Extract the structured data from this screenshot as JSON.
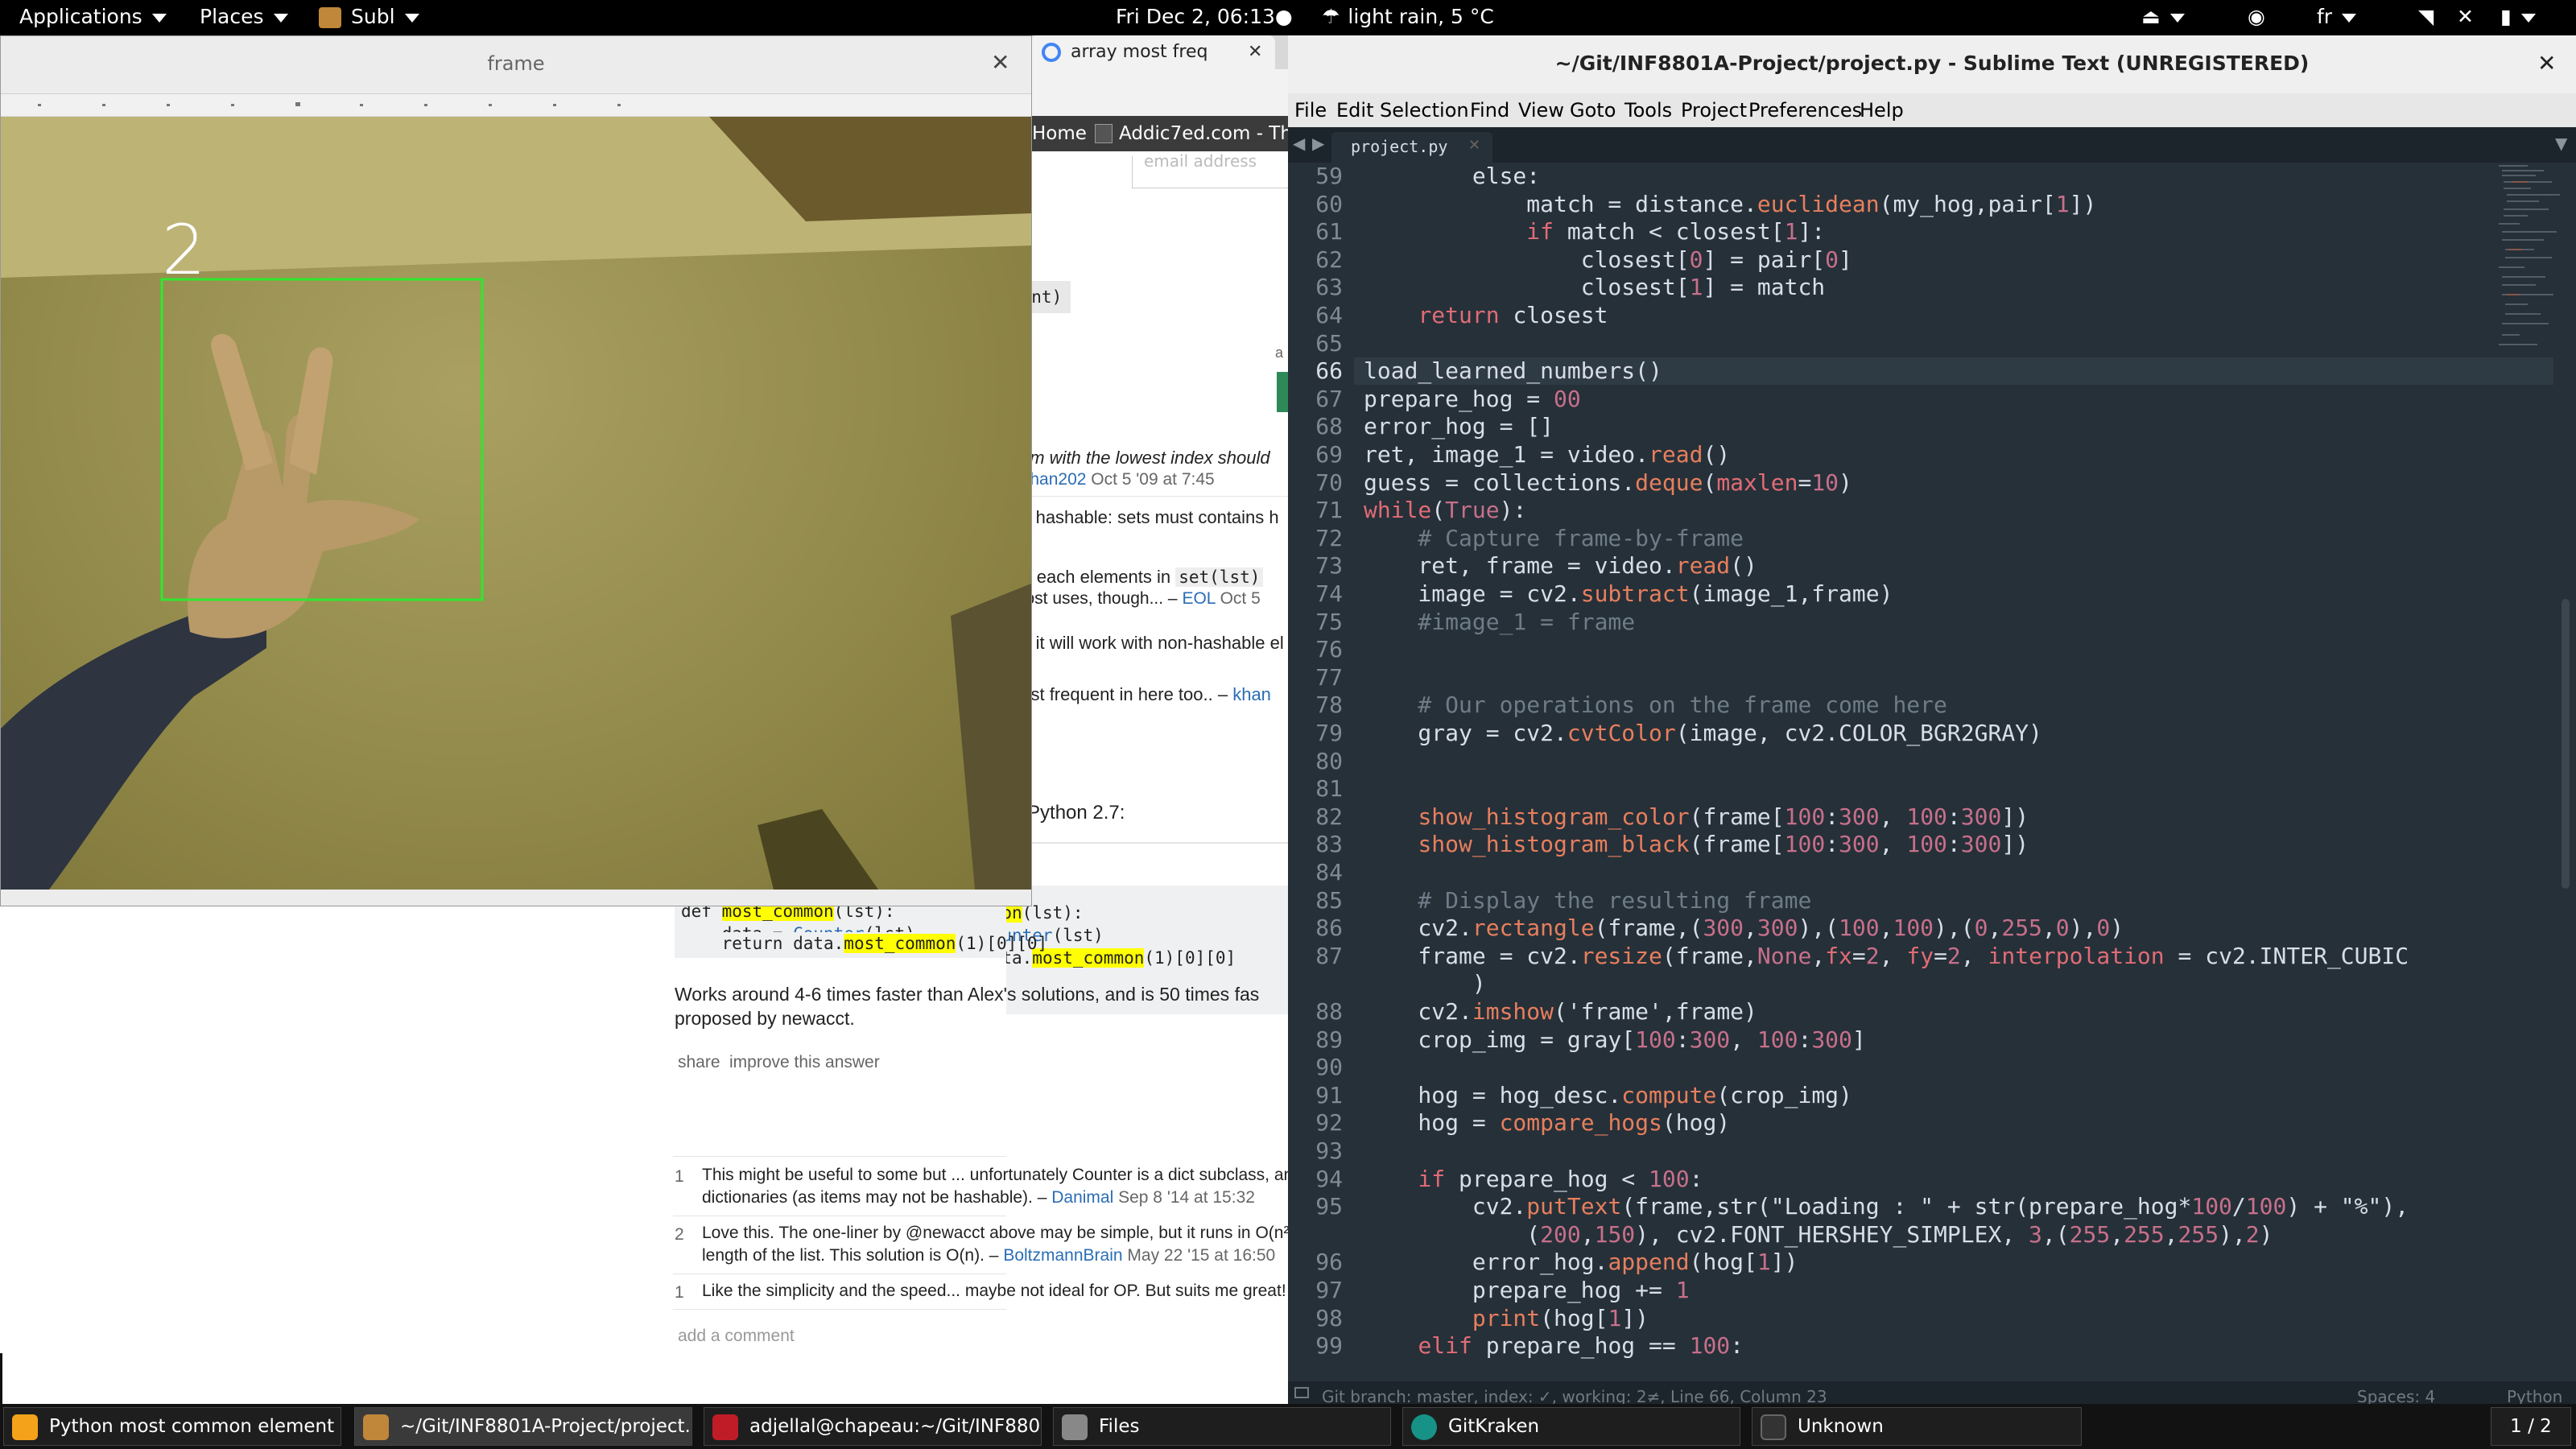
{
  "topbar": {
    "applications": "Applications",
    "places": "Places",
    "subl": "Subl",
    "clock": "Fri Dec  2, 06:13●",
    "weather": "light rain, 5 °C",
    "keyboard": "fr"
  },
  "browser": {
    "tab_label": "array most freq",
    "bookmark_home": "Home",
    "bookmark_addic7ed": "Addic7ed.com - Th",
    "email_hint": "email address",
    "code_snippet": "ount)",
    "comment1_text": "item with the lowest index should",
    "comment1_user": "ephan202",
    "comment1_time": "Oct 5 '09 at 7:45",
    "comment2_text": "be hashable: sets must contains h",
    "comment3_line1": "for each elements in",
    "comment3_code": "set(lst)",
    "comment3_line2": "most uses, though... –",
    "comment3_user": "EOL",
    "comment3_time": "Oct 5",
    "comment4_text": "nd it will work with non-hashable el",
    "comment5_text": "east frequent in here too.. –",
    "comment5_user": "khan",
    "answer_intro": "h Python 2.7:",
    "code_line1_a": "def ",
    "code_line1_fn": "most_common",
    "code_line1_b": "(lst):",
    "code_line2_a": "    data = ",
    "code_line2_cls": "Counter",
    "code_line2_b": "(lst)",
    "code_line3_a": "    return data.",
    "code_line3_fn": "most_common",
    "code_line3_b": "(1)[0][0]",
    "answer_text1": "Works around 4-6 times faster than Alex's solutions, and is 50 times fas",
    "answer_text2": "proposed by newacct.",
    "share": "share",
    "improve": "improve this answer",
    "c1_votes": "1",
    "c1_line1": "This might be useful to some but ... unfortunately Counter is a dict subclass, an",
    "c1_line2": "dictionaries (as items may not be hashable). –",
    "c1_user": "Danimal",
    "c1_time": "Sep 8 '14 at 15:32",
    "c2_votes": "2",
    "c2_line1": "Love this. The one-liner by @newacct above may be simple, but it runs in O(n²",
    "c2_line2": "length of the list. This solution is O(n). –",
    "c2_user": "BoltzmannBrain",
    "c2_time": "May 22 '15 at 16:50",
    "c3_votes": "1",
    "c3_line1": "Like the simplicity and the speed... maybe not ideal for OP. But suits me great!",
    "add_comment": "add a comment"
  },
  "frame_window": {
    "title": "frame",
    "overlay_digit": "2"
  },
  "sublime": {
    "title": "~/Git/INF8801A-Project/project.py - Sublime Text (UNREGISTERED)",
    "menu": [
      "File",
      "Edit",
      "Selection",
      "Find",
      "View",
      "Goto",
      "Tools",
      "Project",
      "Preferences",
      "Help"
    ],
    "tab": "project.py",
    "status_left": "Git branch: master, index: ✓, working: 2≠, Line 66, Column 23",
    "status_spaces": "Spaces: 4",
    "status_syntax": "Python",
    "line_numbers": [
      "59",
      "60",
      "61",
      "62",
      "63",
      "64",
      "65",
      "66",
      "67",
      "68",
      "69",
      "70",
      "71",
      "72",
      "73",
      "74",
      "75",
      "76",
      "77",
      "78",
      "79",
      "80",
      "81",
      "82",
      "83",
      "84",
      "85",
      "86",
      "87",
      "",
      "88",
      "89",
      "90",
      "91",
      "92",
      "93",
      "94",
      "95",
      "",
      "96",
      "97",
      "98",
      "99"
    ]
  },
  "taskbar": {
    "t1": "Python most common element in ...",
    "t2": "~/Git/INF8801A-Project/project....",
    "t3": "adjellal@chapeau:~/Git/INF8801...",
    "t4": "Files",
    "t5": "GitKraken",
    "t6": "Unknown",
    "workspace": "1 / 2"
  },
  "colors": {
    "editor_bg": "#263039",
    "keyword": "#e06c75",
    "number": "#c7708a",
    "function": "#e77f5d",
    "comment": "#6e7c87",
    "detection_box": "#2ee82e",
    "link": "#2a6db5",
    "highlight": "#ffff00"
  }
}
